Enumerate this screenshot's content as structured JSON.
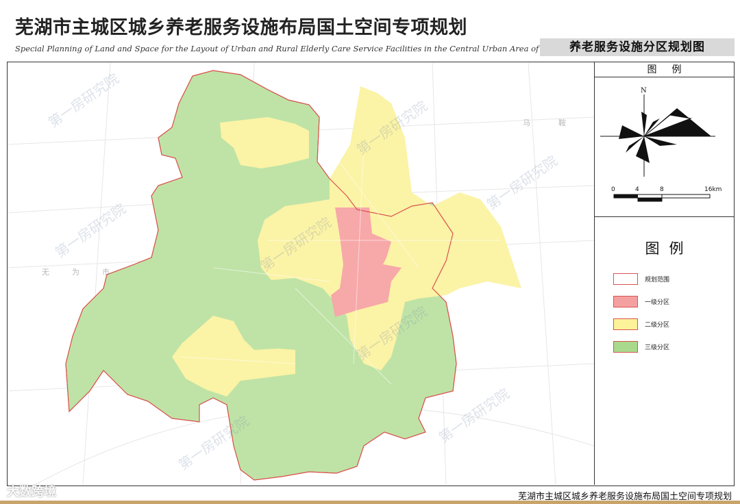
{
  "header": {
    "title_cn": "芜湖市主城区城乡养老服务设施布局国土空间专项规划",
    "title_en": "Special Planning of Land and Space for the Layout of Urban and Rural Elderly Care Service Facilities in the Central Urban Area of Wuhu City",
    "sheet_title": "养老服务设施分区规划图"
  },
  "sidebar": {
    "header_label": "图例",
    "north_label": "N",
    "scale_labels": [
      "0",
      "4",
      "8",
      "16km"
    ],
    "legend_title": "图例",
    "legend_items": [
      {
        "label": "规划范围",
        "fill": "#ffffff",
        "border": "#d9534f"
      },
      {
        "label": "一级分区",
        "fill": "#f5a0a0",
        "border": "#d9534f"
      },
      {
        "label": "二级分区",
        "fill": "#fbf29a",
        "border": "#d9534f"
      },
      {
        "label": "三级分区",
        "fill": "#a9d98c",
        "border": "#d9534f"
      }
    ]
  },
  "map": {
    "zones": {
      "zone1_color": "#f7a8a8",
      "zone2_color": "#fbf3a6",
      "zone3_color": "#bfe3a6",
      "boundary_color": "#d9534f"
    },
    "place_labels": [
      "马",
      "鞍",
      "无",
      "为",
      "市"
    ],
    "watermark": "第一房研究院"
  },
  "footer": {
    "text": "芜湖市主城区城乡养老服务设施布局国土空间专项规划",
    "logo_text": "大数跨境"
  }
}
